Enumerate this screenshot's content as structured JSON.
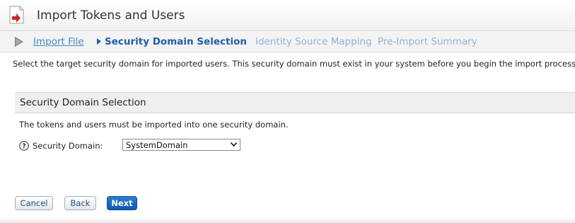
{
  "header": {
    "title": "Import Tokens and Users",
    "icon": "import-document-icon"
  },
  "wizard": {
    "play_icon": "play-icon",
    "steps": [
      {
        "label": "Import File",
        "state": "completed"
      },
      {
        "label": "Security Domain Selection",
        "state": "current"
      },
      {
        "label": "Identity Source Mapping",
        "state": "pending"
      },
      {
        "label": "Pre-Import Summary",
        "state": "pending"
      }
    ]
  },
  "instruction": "Select the target security domain for imported users. This security domain must exist in your system before you begin the import process.",
  "section": {
    "title": "Security Domain Selection",
    "description": "The tokens and users must be imported into one security domain.",
    "field": {
      "label": "Security Domain:",
      "value": "SystemDomain",
      "help_icon": "help-icon"
    }
  },
  "buttons": {
    "cancel": "Cancel",
    "back": "Back",
    "next": "Next"
  },
  "colors": {
    "link": "#4a87c4",
    "current_step": "#1c5fa8",
    "pending_step": "#8fb4d9",
    "primary_button": "#1a6cc0"
  }
}
